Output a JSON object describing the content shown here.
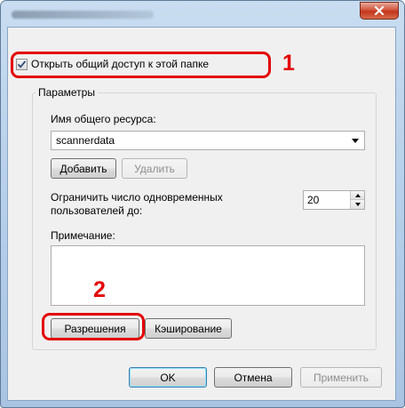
{
  "window": {
    "close_icon": "close-icon"
  },
  "share_checkbox": {
    "label": "Открыть общий доступ к этой папке",
    "checked": true
  },
  "callouts": [
    "1",
    "2"
  ],
  "params": {
    "group_label": "Параметры",
    "share_name_label": "Имя общего ресурса:",
    "share_name_value": "scannerdata",
    "add_button": "Добавить",
    "remove_button": "Удалить",
    "limit_label_line1": "Ограничить число одновременных",
    "limit_label_line2": "пользователей до:",
    "limit_value": "20",
    "comment_label": "Примечание:",
    "comment_value": "",
    "permissions_button": "Разрешения",
    "caching_button": "Кэширование"
  },
  "footer": {
    "ok_button": "OK",
    "cancel_button": "Отмена",
    "apply_button": "Применить"
  },
  "colors": {
    "highlight": "#e30000",
    "window_frame": "#b9d1ea"
  }
}
